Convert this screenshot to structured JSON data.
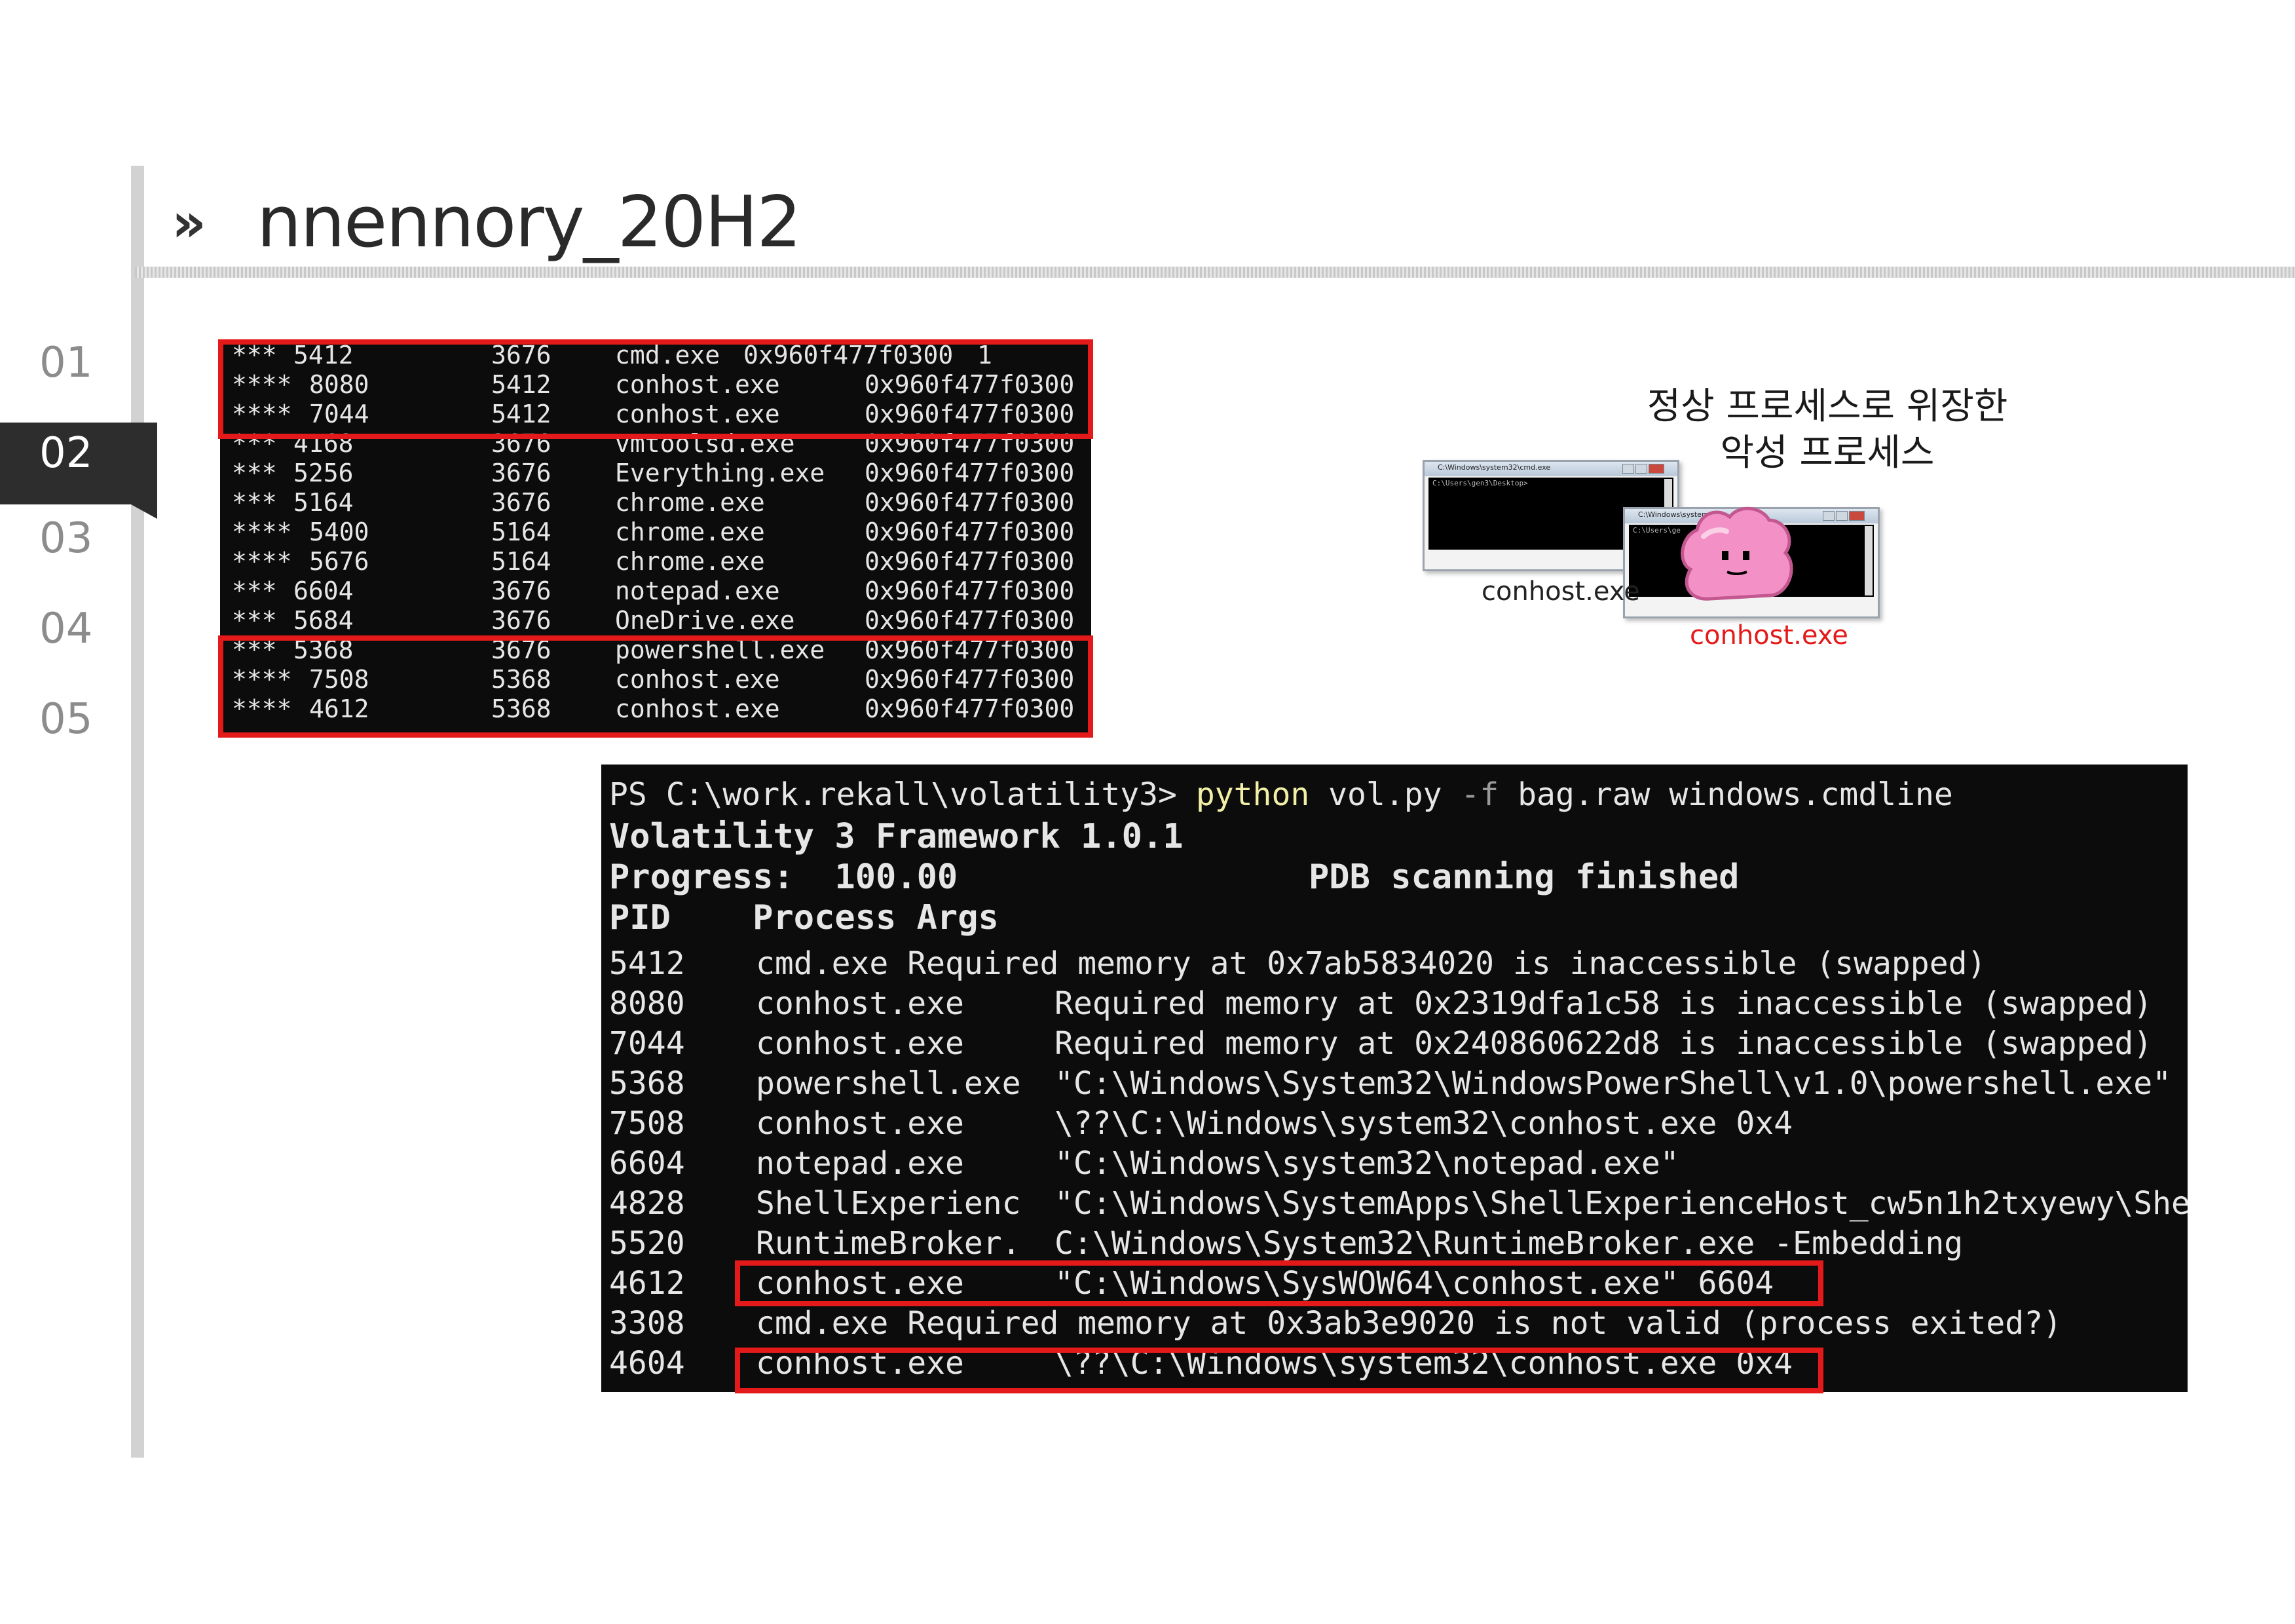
{
  "header": {
    "arrow": "»",
    "title": "nnennory_20H2"
  },
  "nav": {
    "items": [
      "01",
      "02",
      "03",
      "04",
      "05"
    ],
    "active": "02"
  },
  "pstree": {
    "rows": [
      {
        "depth": "***",
        "pid": "5412",
        "ppid": "3676",
        "name": "cmd.exe",
        "offset": "0x960f477f0300",
        "extra": "1"
      },
      {
        "depth": "****",
        "pid": "8080",
        "ppid": "5412",
        "name": "conhost.exe",
        "offset": "0x960f477f0300",
        "extra": ""
      },
      {
        "depth": "****",
        "pid": "7044",
        "ppid": "5412",
        "name": "conhost.exe",
        "offset": "0x960f477f0300",
        "extra": ""
      },
      {
        "depth": "***",
        "pid": "4168",
        "ppid": "3676",
        "name": "vmtoolsd.exe",
        "offset": "0x960f477f0300",
        "extra": ""
      },
      {
        "depth": "***",
        "pid": "5256",
        "ppid": "3676",
        "name": "Everything.exe",
        "offset": "0x960f477f0300",
        "extra": ""
      },
      {
        "depth": "***",
        "pid": "5164",
        "ppid": "3676",
        "name": "chrome.exe",
        "offset": "0x960f477f0300",
        "extra": ""
      },
      {
        "depth": "****",
        "pid": "5400",
        "ppid": "5164",
        "name": "chrome.exe",
        "offset": "0x960f477f0300",
        "extra": ""
      },
      {
        "depth": "****",
        "pid": "5676",
        "ppid": "5164",
        "name": "chrome.exe",
        "offset": "0x960f477f0300",
        "extra": ""
      },
      {
        "depth": "***",
        "pid": "6604",
        "ppid": "3676",
        "name": "notepad.exe",
        "offset": "0x960f477f0300",
        "extra": ""
      },
      {
        "depth": "***",
        "pid": "5684",
        "ppid": "3676",
        "name": "OneDrive.exe",
        "offset": "0x960f477f0300",
        "extra": ""
      },
      {
        "depth": "***",
        "pid": "5368",
        "ppid": "3676",
        "name": "powershell.exe",
        "offset": "0x960f477f0300",
        "extra": ""
      },
      {
        "depth": "****",
        "pid": "7508",
        "ppid": "5368",
        "name": "conhost.exe",
        "offset": "0x960f477f0300",
        "extra": ""
      },
      {
        "depth": "****",
        "pid": "4612",
        "ppid": "5368",
        "name": "conhost.exe",
        "offset": "0x960f477f0300",
        "extra": ""
      }
    ]
  },
  "cmdline_terminal": {
    "prompt": "PS C:\\work.rekall\\volatility3>",
    "command": "python",
    "script": "vol.py",
    "flag": "-f",
    "args": "bag.raw windows.cmdline",
    "banner": "Volatility 3 Framework 1.0.1",
    "progress_label": "Progress:",
    "progress_value": "100.00",
    "status": "PDB scanning finished",
    "col_pid": "PID",
    "col_process": "Process",
    "col_args": "Args",
    "rows": [
      {
        "pid": "5412",
        "line": "cmd.exe Required memory at 0x7ab5834020 is inaccessible (swapped)"
      },
      {
        "pid": "8080",
        "name": "conhost.exe",
        "args": "Required memory at 0x2319dfa1c58 is inaccessible (swapped)"
      },
      {
        "pid": "7044",
        "name": "conhost.exe",
        "args": "Required memory at 0x240860622d8 is inaccessible (swapped)"
      },
      {
        "pid": "5368",
        "name": "powershell.exe",
        "args": "\"C:\\Windows\\System32\\WindowsPowerShell\\v1.0\\powershell.exe\""
      },
      {
        "pid": "7508",
        "name": "conhost.exe",
        "args": "\\??\\C:\\Windows\\system32\\conhost.exe 0x4"
      },
      {
        "pid": "6604",
        "name": "notepad.exe",
        "args": "\"C:\\Windows\\system32\\notepad.exe\""
      },
      {
        "pid": "4828",
        "name": "ShellExperienc",
        "args": "\"C:\\Windows\\SystemApps\\ShellExperienceHost_cw5n1h2txyewy\\Shel"
      },
      {
        "pid": "5520",
        "name": "RuntimeBroker.",
        "args": "C:\\Windows\\System32\\RuntimeBroker.exe -Embedding"
      },
      {
        "pid": "4612",
        "name": "conhost.exe",
        "args": "\"C:\\Windows\\SysWOW64\\conhost.exe\" 6604"
      },
      {
        "pid": "3308",
        "line": "cmd.exe Required memory at 0x3ab3e9020 is not valid (process exited?)"
      },
      {
        "pid": "4604",
        "name": "conhost.exe",
        "args": "\\??\\C:\\Windows\\system32\\conhost.exe 0x4"
      }
    ]
  },
  "illustration": {
    "caption_line1": "정상 프로세스로 위장한",
    "caption_line2": "악성 프로세스",
    "normal_label": "conhost.exe",
    "malicious_label": "conhost.exe",
    "window1_title": "C:\\Windows\\system32\\cmd.exe",
    "window1_text": "C:\\Users\\gen3\\Desktop>",
    "window2_title": "C:\\Windows\\system32",
    "window2_text": "C:\\Users\\ge",
    "highlight_color": "#e41a1a"
  }
}
